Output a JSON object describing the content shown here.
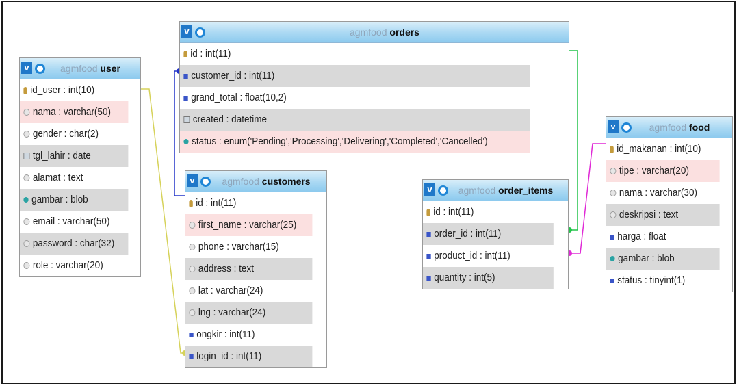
{
  "diagram": {
    "tables": {
      "user": {
        "db": "agmfood",
        "name": "user",
        "columns": [
          {
            "text": "id_user : int(10)",
            "icon": "primary-key-icon"
          },
          {
            "text": "nama : varchar(50)",
            "icon": "text-column-icon"
          },
          {
            "text": "gender : char(2)",
            "icon": "text-column-icon"
          },
          {
            "text": "tgl_lahir : date",
            "icon": "date-column-icon"
          },
          {
            "text": "alamat : text",
            "icon": "text-column-icon"
          },
          {
            "text": "gambar : blob",
            "icon": "blob-column-icon"
          },
          {
            "text": "email : varchar(50)",
            "icon": "text-column-icon"
          },
          {
            "text": "password : char(32)",
            "icon": "text-column-icon"
          },
          {
            "text": "role : varchar(20)",
            "icon": "text-column-icon"
          }
        ]
      },
      "orders": {
        "db": "agmfood",
        "name": "orders",
        "columns": [
          {
            "text": "id : int(11)",
            "icon": "primary-key-icon"
          },
          {
            "text": "customer_id : int(11)",
            "icon": "numeric-column-icon"
          },
          {
            "text": "grand_total : float(10,2)",
            "icon": "numeric-column-icon"
          },
          {
            "text": "created : datetime",
            "icon": "date-column-icon"
          },
          {
            "text": "status : enum('Pending','Processing','Delivering','Completed','Cancelled')",
            "icon": "enum-column-icon"
          }
        ]
      },
      "customers": {
        "db": "agmfood",
        "name": "customers",
        "columns": [
          {
            "text": "id : int(11)",
            "icon": "primary-key-icon"
          },
          {
            "text": "first_name : varchar(25)",
            "icon": "text-column-icon"
          },
          {
            "text": "phone : varchar(15)",
            "icon": "text-column-icon"
          },
          {
            "text": "address : text",
            "icon": "text-column-icon"
          },
          {
            "text": "lat : varchar(24)",
            "icon": "text-column-icon"
          },
          {
            "text": "lng : varchar(24)",
            "icon": "text-column-icon"
          },
          {
            "text": "ongkir : int(11)",
            "icon": "numeric-column-icon"
          },
          {
            "text": "login_id : int(11)",
            "icon": "numeric-column-icon"
          }
        ]
      },
      "order_items": {
        "db": "agmfood",
        "name": "order_items",
        "columns": [
          {
            "text": "id : int(11)",
            "icon": "primary-key-icon"
          },
          {
            "text": "order_id : int(11)",
            "icon": "numeric-column-icon"
          },
          {
            "text": "product_id : int(11)",
            "icon": "numeric-column-icon"
          },
          {
            "text": "quantity : int(5)",
            "icon": "numeric-column-icon"
          }
        ]
      },
      "food": {
        "db": "agmfood",
        "name": "food",
        "columns": [
          {
            "text": "id_makanan : int(10)",
            "icon": "primary-key-icon"
          },
          {
            "text": "tipe : varchar(20)",
            "icon": "text-column-icon"
          },
          {
            "text": "nama : varchar(30)",
            "icon": "text-column-icon"
          },
          {
            "text": "deskripsi : text",
            "icon": "text-column-icon"
          },
          {
            "text": "harga : float",
            "icon": "numeric-column-icon"
          },
          {
            "text": "gambar : blob",
            "icon": "blob-column-icon"
          },
          {
            "text": "status : tinyint(1)",
            "icon": "numeric-column-icon"
          }
        ]
      }
    },
    "relations": [
      {
        "from": "customers.login_id",
        "to": "user.id_user",
        "color": "#d6d25a"
      },
      {
        "from": "orders.customer_id",
        "to": "customers.id",
        "color": "#2233c8"
      },
      {
        "from": "order_items.order_id",
        "to": "orders.id",
        "color": "#22c44a"
      },
      {
        "from": "order_items.product_id",
        "to": "food.id_makanan",
        "color": "#e02ad6"
      }
    ]
  }
}
